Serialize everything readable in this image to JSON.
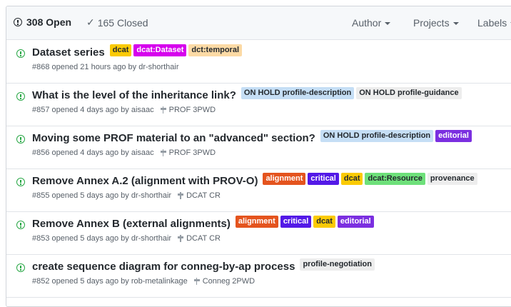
{
  "header": {
    "open_label": "308 Open",
    "closed_label": "165 Closed",
    "filters": [
      "Author",
      "Projects",
      "Labels"
    ]
  },
  "colors": {
    "open_green": "#28a745",
    "label_dcat": "#fbca04",
    "label_dcat_dataset": "#d600ed",
    "label_dct_temporal": "#fcdaa5",
    "label_on_hold": "#c5def5",
    "label_editorial": "#7b2fe0",
    "label_alignment": "#e4541e",
    "label_critical": "#5319e7",
    "label_dcat_resource": "#6ee07a",
    "label_plain": "#ededed"
  },
  "issues": [
    {
      "title": "Dataset series",
      "labels": [
        {
          "name": "dcat",
          "bg": "#fbca04",
          "fg": "#24292e"
        },
        {
          "name": "dcat:Dataset",
          "bg": "#d600ed",
          "fg": "#ffffff"
        },
        {
          "name": "dct:temporal",
          "bg": "#fcdaa5",
          "fg": "#24292e"
        }
      ],
      "meta": "#868 opened 21 hours ago by dr-shorthair",
      "milestone": ""
    },
    {
      "title": "What is the level of the inheritance link?",
      "labels": [
        {
          "name": "ON HOLD profile-description",
          "bg": "#c5def5",
          "fg": "#24292e"
        },
        {
          "name": "ON HOLD profile-guidance",
          "bg": "#ededed",
          "fg": "#24292e"
        }
      ],
      "meta": "#857 opened 4 days ago by aisaac",
      "milestone": "PROF 3PWD"
    },
    {
      "title": "Moving some PROF material to an \"advanced\" section?",
      "labels": [
        {
          "name": "ON HOLD profile-description",
          "bg": "#c5def5",
          "fg": "#24292e"
        },
        {
          "name": "editorial",
          "bg": "#7b2fe0",
          "fg": "#ffffff"
        }
      ],
      "meta": "#856 opened 4 days ago by aisaac",
      "milestone": "PROF 3PWD"
    },
    {
      "title": "Remove Annex A.2 (alignment with PROV-O)",
      "labels": [
        {
          "name": "alignment",
          "bg": "#e4541e",
          "fg": "#ffffff"
        },
        {
          "name": "critical",
          "bg": "#5319e7",
          "fg": "#ffffff"
        },
        {
          "name": "dcat",
          "bg": "#fbca04",
          "fg": "#24292e"
        },
        {
          "name": "dcat:Resource",
          "bg": "#6ee07a",
          "fg": "#24292e"
        },
        {
          "name": "provenance",
          "bg": "#ededed",
          "fg": "#24292e"
        }
      ],
      "meta": "#855 opened 5 days ago by dr-shorthair",
      "milestone": "DCAT CR"
    },
    {
      "title": "Remove Annex B (external alignments)",
      "labels": [
        {
          "name": "alignment",
          "bg": "#e4541e",
          "fg": "#ffffff"
        },
        {
          "name": "critical",
          "bg": "#5319e7",
          "fg": "#ffffff"
        },
        {
          "name": "dcat",
          "bg": "#fbca04",
          "fg": "#24292e"
        },
        {
          "name": "editorial",
          "bg": "#7b2fe0",
          "fg": "#ffffff"
        }
      ],
      "meta": "#853 opened 5 days ago by dr-shorthair",
      "milestone": "DCAT CR"
    },
    {
      "title": "create sequence diagram for conneg-by-ap process",
      "labels": [
        {
          "name": "profile-negotiation",
          "bg": "#ededed",
          "fg": "#24292e"
        }
      ],
      "meta": "#852 opened 5 days ago by rob-metalinkage",
      "milestone": "Conneg 2PWD"
    }
  ]
}
